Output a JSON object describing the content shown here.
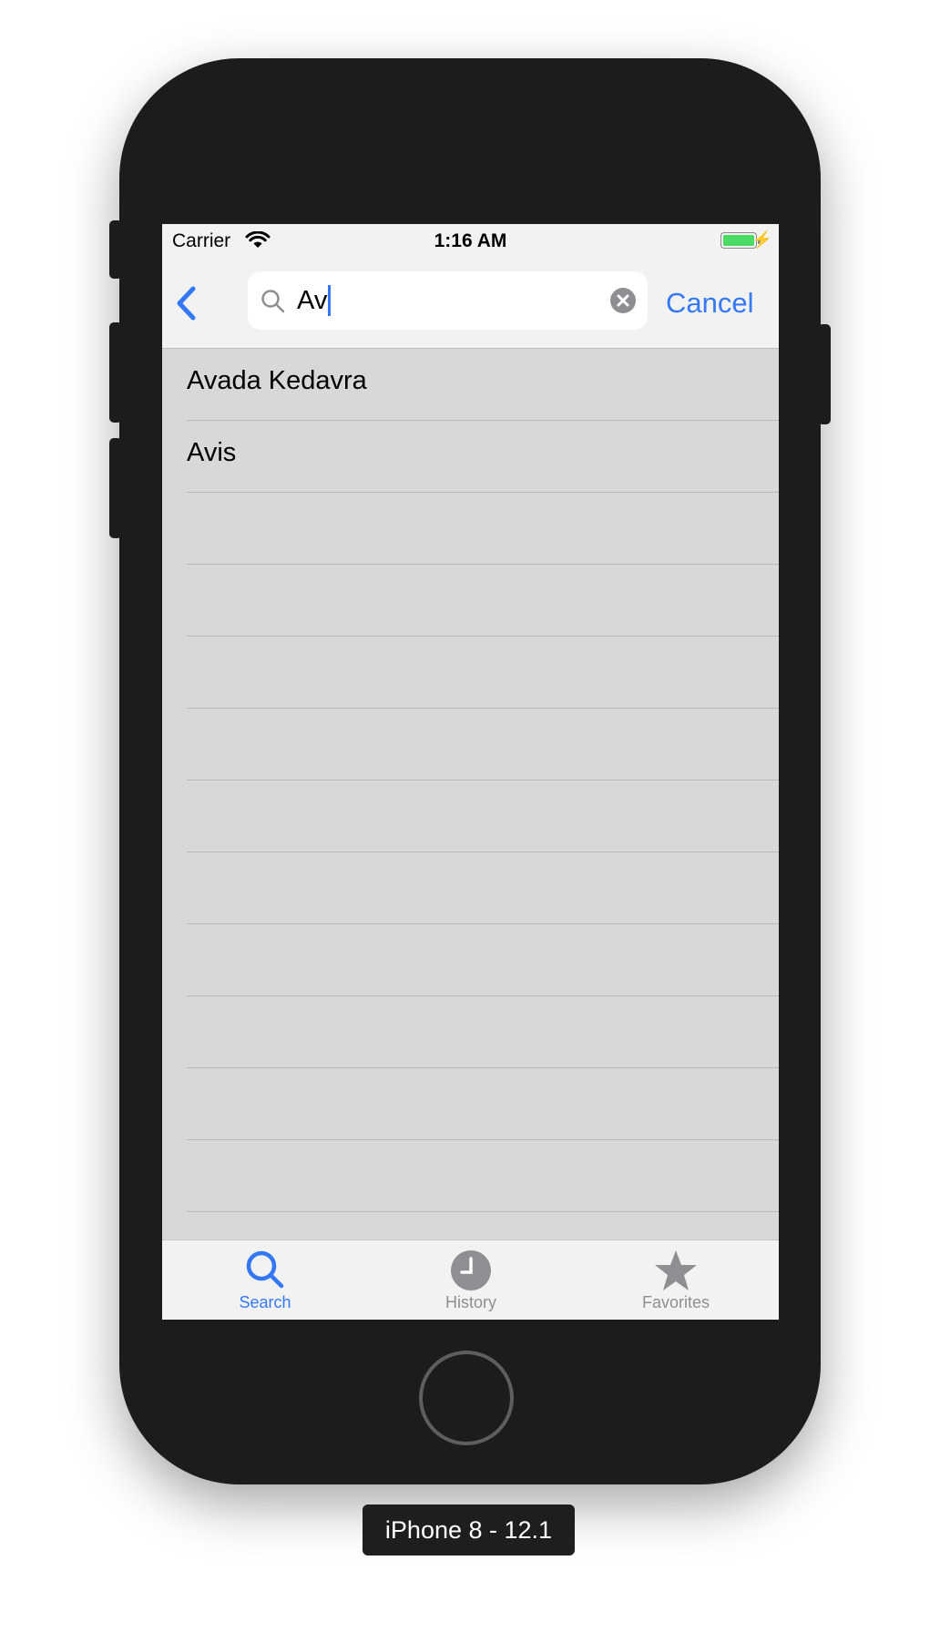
{
  "status_bar": {
    "carrier": "Carrier",
    "time": "1:16 AM",
    "battery": 1.0
  },
  "nav": {
    "back_icon": "chevron-left-icon",
    "search_icon": "magnifier-icon",
    "search_value": "Av",
    "clear_icon": "clear-circle-icon",
    "cancel_label": "Cancel"
  },
  "results": [
    {
      "label": "Avada Kedavra"
    },
    {
      "label": "Avis"
    },
    {
      "label": ""
    },
    {
      "label": ""
    },
    {
      "label": ""
    },
    {
      "label": ""
    },
    {
      "label": ""
    },
    {
      "label": ""
    },
    {
      "label": ""
    },
    {
      "label": ""
    },
    {
      "label": ""
    },
    {
      "label": ""
    },
    {
      "label": ""
    }
  ],
  "tabs": [
    {
      "label": "Search",
      "icon": "search-icon",
      "active": true
    },
    {
      "label": "History",
      "icon": "clock-icon",
      "active": false
    },
    {
      "label": "Favorites",
      "icon": "star-icon",
      "active": false
    }
  ],
  "device_label": "iPhone 8 - 12.1",
  "colors": {
    "accent": "#3478f6",
    "list_background": "#d8d8d8",
    "bar_background": "#f2f2f2",
    "device_body": "#1c1c1c"
  }
}
